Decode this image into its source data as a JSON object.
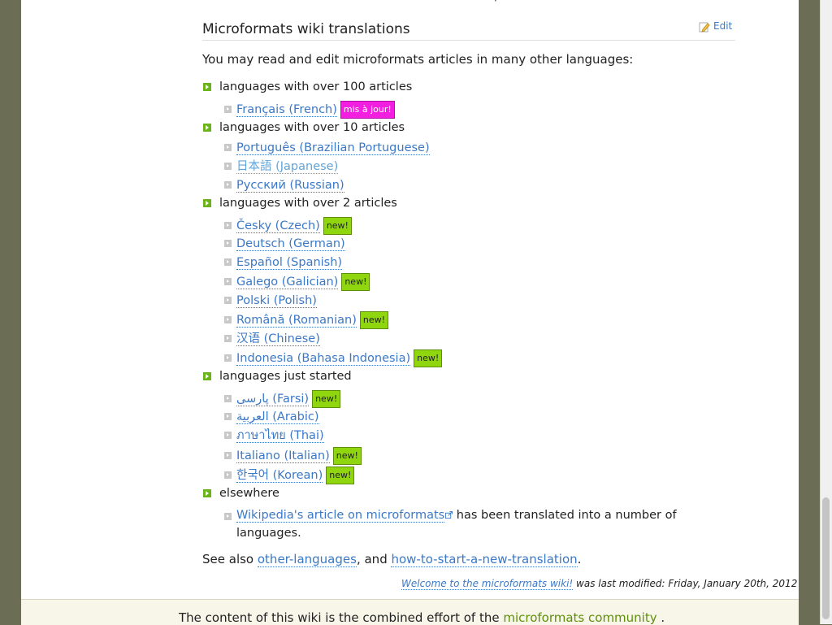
{
  "top_fragment": "·",
  "section": {
    "title": "Microformats wiki translations",
    "edit_label": "Edit"
  },
  "intro": "You may read and edit microformats articles in many other languages:",
  "groups": [
    {
      "label": "languages with over 100 articles",
      "items": [
        {
          "name": "Français (French)",
          "badge": "mis à jour!"
        }
      ]
    },
    {
      "label": "languages with over 10 articles",
      "items": [
        {
          "name": "Português (Brazilian Portuguese)"
        },
        {
          "name": "日本語 (Japanese)"
        },
        {
          "name": "Русский (Russian)"
        }
      ]
    },
    {
      "label": "languages with over 2 articles",
      "items": [
        {
          "name": "Česky (Czech)",
          "badge": "new!"
        },
        {
          "name": "Deutsch (German)"
        },
        {
          "name": "Español (Spanish)"
        },
        {
          "name": "Galego (Galician)",
          "badge": "new!"
        },
        {
          "name": "Polski (Polish)"
        },
        {
          "name": "Română (Romanian)",
          "badge": "new!"
        },
        {
          "name": "汉语 (Chinese)"
        },
        {
          "name": "Indonesia (Bahasa Indonesia)",
          "badge": "new!"
        }
      ]
    },
    {
      "label": "languages just started",
      "items": [
        {
          "name": "پارسی (Farsi)",
          "badge": "new!"
        },
        {
          "name": "العربية (Arabic)"
        },
        {
          "name": "ภาษาไทย (Thai)"
        },
        {
          "name": "Italiano (Italian)",
          "badge": "new!"
        },
        {
          "name": "한국어 (Korean)",
          "badge": "new!"
        }
      ]
    },
    {
      "label": "elsewhere",
      "note": {
        "link": "Wikipedia's article on microformats",
        "text": " has been translated into a number of languages."
      }
    }
  ],
  "see_also": {
    "prefix": "See also ",
    "link1": "other-languages",
    "middle": ", and ",
    "link2": "how-to-start-a-new-translation",
    "suffix": "."
  },
  "last_modified": {
    "link": "Welcome to the microformats wiki!",
    "text": " was last modified: Friday, January 20th, 2012"
  },
  "footer": {
    "text": "The content of this wiki is the combined effort of the ",
    "link": "microformats community",
    "suffix": " ."
  },
  "colors": {
    "link": "#3b78c6",
    "new_badge": "#8fd60f",
    "update_badge": "#f21ee0",
    "bullet": "#6ab31b",
    "footer_link": "#5e8f0a"
  }
}
